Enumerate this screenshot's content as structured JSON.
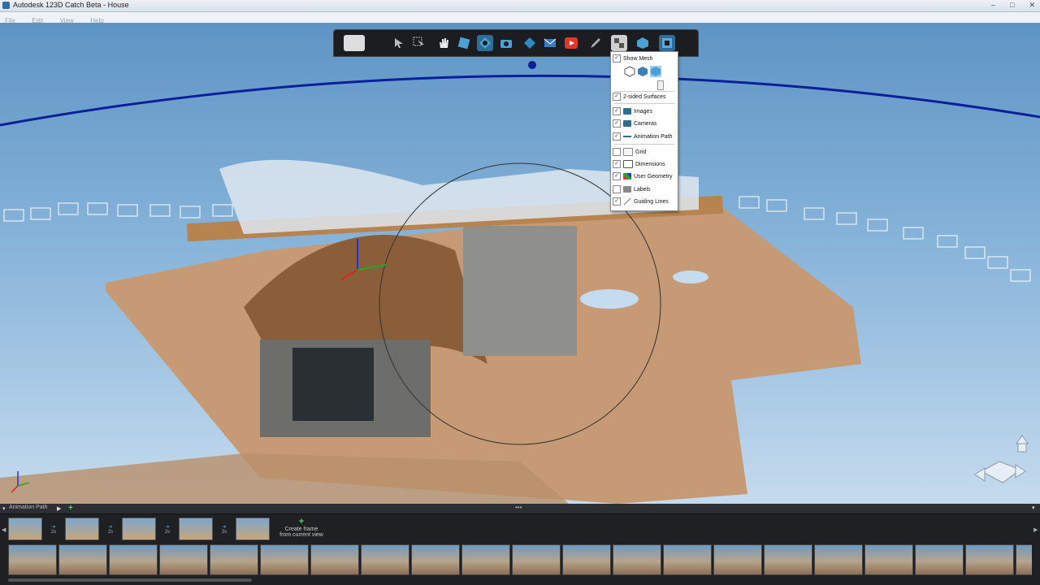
{
  "window": {
    "title": "Autodesk 123D Catch Beta - House",
    "controls": [
      "–",
      "□",
      "✕"
    ]
  },
  "menu": [
    "File",
    "Edit",
    "View",
    "Help"
  ],
  "toolbar": {
    "tools": [
      {
        "name": "select-icon",
        "color": "#bbbbbb"
      },
      {
        "name": "select-region-icon",
        "color": "#bbbbbb"
      },
      {
        "name": "pan-hand-icon",
        "color": "#e9e9e9"
      },
      {
        "name": "zoom-icon",
        "color": "#4ba0d8"
      },
      {
        "name": "orbit-icon",
        "color": "#4ba0d8"
      },
      {
        "name": "camera-view-icon",
        "color": "#4ba0d8"
      },
      {
        "name": "measure-icon",
        "color": "#2f88c4"
      },
      {
        "name": "email-icon",
        "color": "#3a7bc0"
      },
      {
        "name": "youtube-icon",
        "color": "#d83a2b"
      },
      {
        "name": "edit-pencil-icon",
        "color": "#aaaaaa"
      },
      {
        "name": "display-options-icon",
        "color": "#cfcfcf"
      },
      {
        "name": "mesh-cube-icon",
        "color": "#4ba0d8"
      },
      {
        "name": "export-icon",
        "color": "#5aa8e0"
      }
    ]
  },
  "display_menu": {
    "show_mesh": {
      "label": "Show Mesh",
      "checked": true
    },
    "two_sided": {
      "label": "2-sided Surfaces",
      "checked": true
    },
    "items": [
      {
        "label": "Images",
        "checked": true,
        "icon": "image-icon"
      },
      {
        "label": "Cameras",
        "checked": true,
        "icon": "camera-icon"
      },
      {
        "label": "Animation Path",
        "checked": true,
        "icon": "path-icon"
      },
      {
        "label": "Grid",
        "checked": false,
        "icon": "grid-icon"
      },
      {
        "label": "Dimensions",
        "checked": true,
        "icon": "dimensions-icon"
      },
      {
        "label": "User Geometry",
        "checked": true,
        "icon": "geometry-icon"
      },
      {
        "label": "Labels",
        "checked": false,
        "icon": "labels-icon"
      },
      {
        "label": "Guiding Lines",
        "checked": true,
        "icon": "guide-lines-icon"
      }
    ]
  },
  "animation_panel": {
    "label": "Animation Path",
    "frames": 5,
    "transition_labels": [
      "2s",
      "2s",
      "2s",
      "2s"
    ],
    "create_frame": {
      "line1": "Create frame",
      "line2": "from current view"
    }
  },
  "photo_strip_count": 21,
  "colors": {
    "sky": "#6f9fcd",
    "path_line": "#0b1f9c",
    "accent": "#4ba0d8"
  }
}
